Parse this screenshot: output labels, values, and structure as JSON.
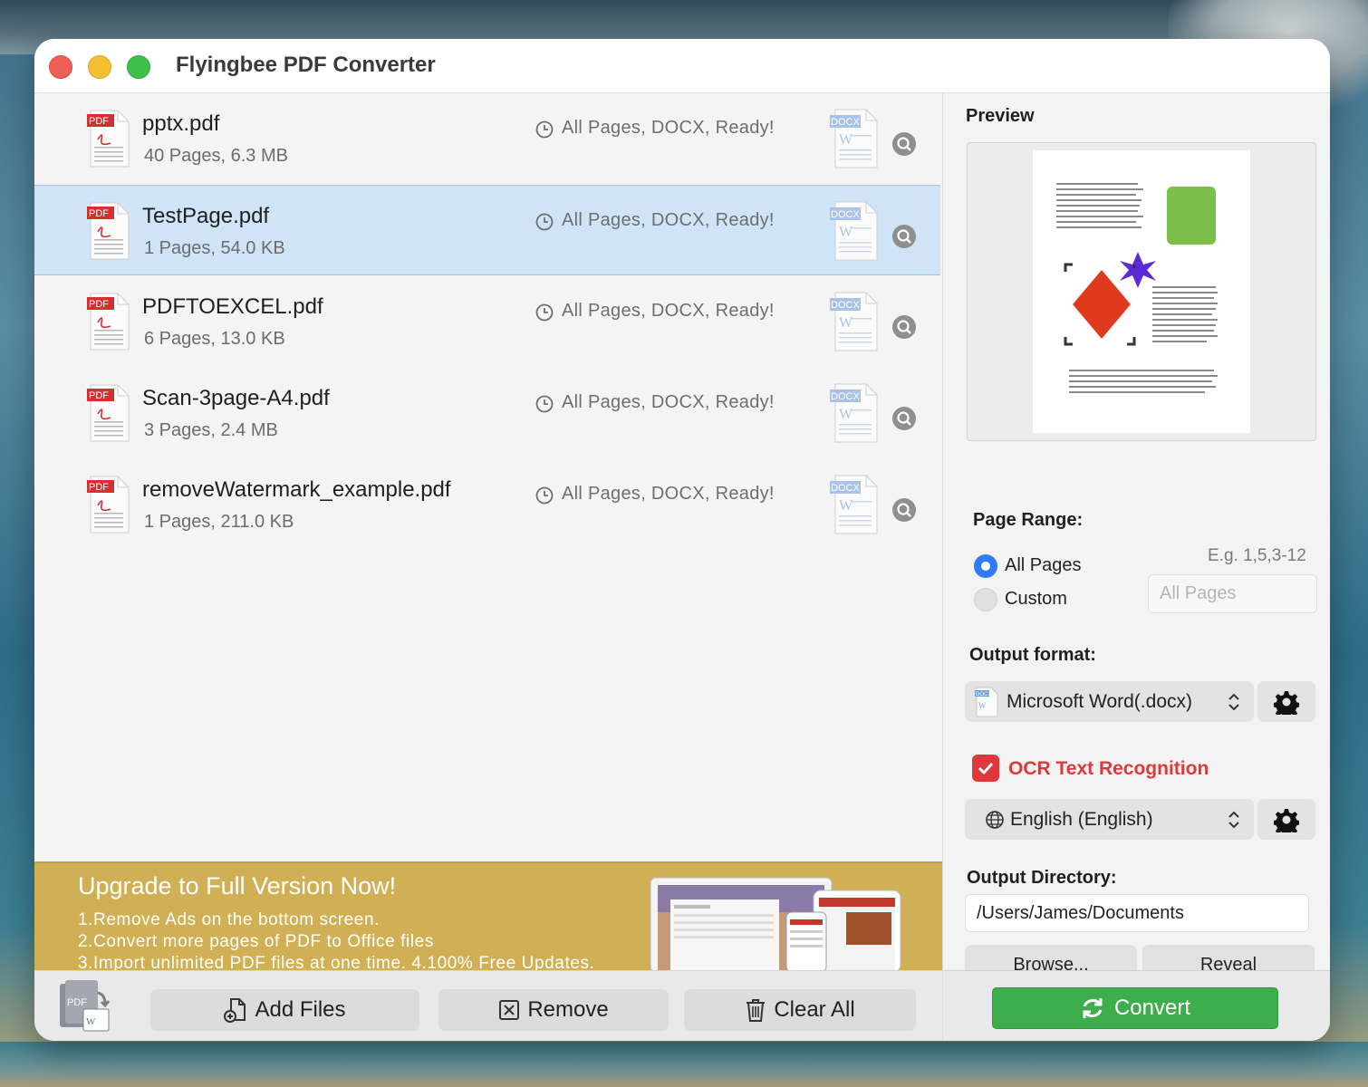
{
  "window": {
    "title": "Flyingbee PDF Converter"
  },
  "files": [
    {
      "name": "pptx.pdf",
      "meta": "40 Pages, 6.3 MB",
      "status": "All Pages, DOCX, Ready!",
      "selected": false
    },
    {
      "name": "TestPage.pdf",
      "meta": "1 Pages, 54.0 KB",
      "status": "All Pages, DOCX, Ready!",
      "selected": true
    },
    {
      "name": "PDFTOEXCEL.pdf",
      "meta": "6 Pages, 13.0 KB",
      "status": "All Pages, DOCX, Ready!",
      "selected": false
    },
    {
      "name": "Scan-3page-A4.pdf",
      "meta": "3 Pages, 2.4 MB",
      "status": "All Pages, DOCX, Ready!",
      "selected": false
    },
    {
      "name": "removeWatermark_example.pdf",
      "meta": "1 Pages, 211.0 KB",
      "status": "All Pages, DOCX, Ready!",
      "selected": false
    }
  ],
  "icons": {
    "file": "pdf-file-icon",
    "target": "docx-file-icon",
    "status": "clock-icon",
    "preview": "magnifier-icon"
  },
  "ad": {
    "title": "Upgrade to Full Version Now!",
    "lines": [
      "1.Remove Ads on the bottom screen.",
      "2.Convert more  pages of PDF to Office files",
      "3.Import unlimited PDF files at one time. 4.100% Free Updates."
    ]
  },
  "toolbar": {
    "add_files": "Add Files",
    "remove": "Remove",
    "clear_all": "Clear All"
  },
  "panel": {
    "preview_label": "Preview",
    "page_range_label": "Page Range:",
    "all_pages": "All Pages",
    "custom": "Custom",
    "range_hint": "E.g. 1,5,3-12",
    "range_placeholder": "All Pages",
    "page_range_selected": "All Pages",
    "output_format_label": "Output format:",
    "output_format": "Microsoft Word(.docx)",
    "ocr_label": "OCR Text Recognition",
    "ocr_checked": true,
    "ocr_language": "English (English)",
    "output_dir_label": "Output Directory:",
    "output_dir": "/Users/James/Documents",
    "browse": "Browse...",
    "reveal": "Reveal",
    "convert": "Convert"
  },
  "colors": {
    "accent": "#2f7cf6",
    "selection": "#cfe4f7",
    "ocr": "#e0393c",
    "convert": "#3ead4c",
    "ad": "#d1b055"
  }
}
